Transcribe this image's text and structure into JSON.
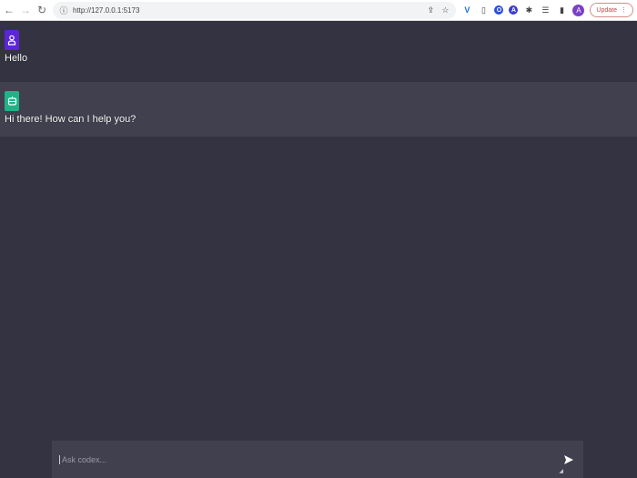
{
  "browser": {
    "url": "http://127.0.0.1:5173",
    "profile_initial": "A",
    "update_label": "Update",
    "extensions": [
      "V",
      "O",
      "A"
    ]
  },
  "messages": [
    {
      "role": "user",
      "text": "Hello"
    },
    {
      "role": "bot",
      "text": "Hi there! How can I help you?"
    }
  ],
  "input": {
    "placeholder": "Ask codex...",
    "value": ""
  },
  "colors": {
    "background": "#343341",
    "bot_row": "#41404f",
    "user_avatar": "#5a27d8",
    "bot_avatar": "#1fb487"
  }
}
